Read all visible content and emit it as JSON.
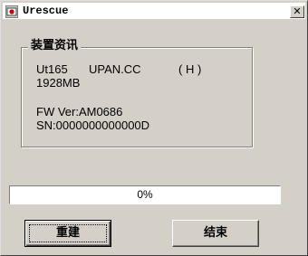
{
  "window": {
    "title": "Urescue",
    "close_glyph": "✕",
    "app_icon": "urescue-app-icon"
  },
  "device_info": {
    "group_label": "装置资讯",
    "line1_model": "Ut165",
    "line1_vendor": "UPAN.CC",
    "line1_drive": "( H )",
    "capacity": "1928MB",
    "firmware": "FW Ver:AM0686",
    "serial": "SN:0000000000000D"
  },
  "progress": {
    "percent": 0,
    "label": "0%"
  },
  "buttons": {
    "rebuild": "重建",
    "finish": "结束"
  },
  "colors": {
    "face": "#d4d0c8",
    "progress_fill": "#0a246a"
  }
}
